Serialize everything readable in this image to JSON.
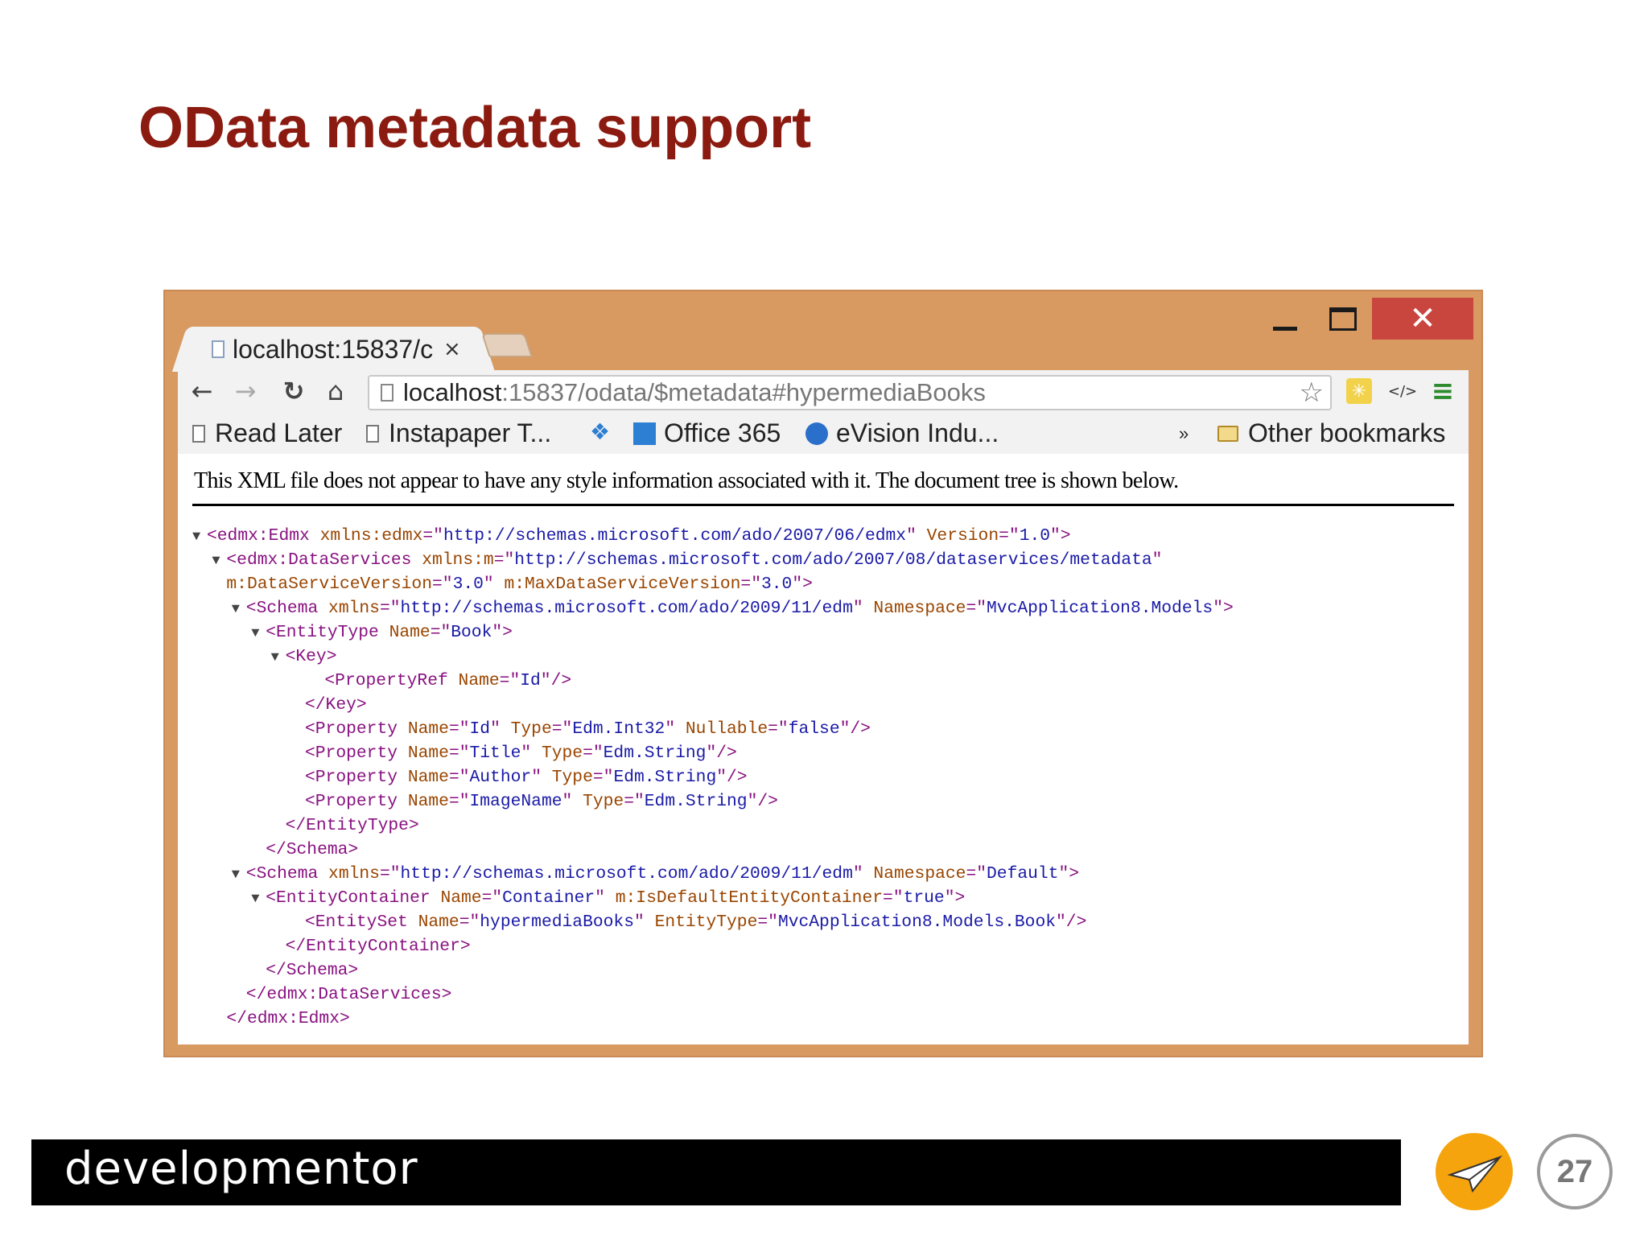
{
  "slide": {
    "title": "OData metadata support",
    "brand": "developmentor",
    "page_number": "27"
  },
  "window": {
    "close_glyph": "✕"
  },
  "tab": {
    "title": "localhost:15837/c",
    "close_glyph": "×"
  },
  "toolbar": {
    "back_icon": "←",
    "forward_icon": "→",
    "reload_icon": "↻",
    "home_icon": "⌂",
    "url_host": "localhost",
    "url_path": ":15837/odata/$metadata#hypermediaBooks",
    "star_icon": "☆",
    "devtools_icon": "</>",
    "menu_icon": "≡"
  },
  "bookmarks": {
    "items": [
      "Read Later",
      "Instapaper T...",
      "Office 365",
      "eVision Indu..."
    ],
    "overflow": "»",
    "other": "Other bookmarks"
  },
  "xml_view": {
    "notice": "This XML file does not appear to have any style information associated with it. The document tree is shown below."
  },
  "xml_lines": [
    {
      "tri": "▼",
      "indent": 0,
      "parts": [
        [
          "t",
          "<edmx:Edmx "
        ],
        [
          "a",
          "xmlns:edmx"
        ],
        [
          "t",
          "=\""
        ],
        [
          "v",
          "http://schemas.microsoft.com/ado/2007/06/edmx"
        ],
        [
          "t",
          "\" "
        ],
        [
          "a",
          "Version"
        ],
        [
          "t",
          "=\""
        ],
        [
          "v",
          "1.0"
        ],
        [
          "t",
          "\">"
        ]
      ]
    },
    {
      "tri": "▼",
      "indent": 1,
      "parts": [
        [
          "t",
          "<edmx:DataServices "
        ],
        [
          "a",
          "xmlns:m"
        ],
        [
          "t",
          "=\""
        ],
        [
          "v",
          "http://schemas.microsoft.com/ado/2007/08/dataservices/metadata"
        ],
        [
          "t",
          "\""
        ]
      ]
    },
    {
      "tri": "",
      "indent": 1,
      "parts": [
        [
          "a",
          "m:DataServiceVersion"
        ],
        [
          "t",
          "=\""
        ],
        [
          "v",
          "3.0"
        ],
        [
          "t",
          "\" "
        ],
        [
          "a",
          "m:MaxDataServiceVersion"
        ],
        [
          "t",
          "=\""
        ],
        [
          "v",
          "3.0"
        ],
        [
          "t",
          "\">"
        ]
      ]
    },
    {
      "tri": "▼",
      "indent": 2,
      "parts": [
        [
          "t",
          "<Schema "
        ],
        [
          "a",
          "xmlns"
        ],
        [
          "t",
          "=\""
        ],
        [
          "v",
          "http://schemas.microsoft.com/ado/2009/11/edm"
        ],
        [
          "t",
          "\" "
        ],
        [
          "a",
          "Namespace"
        ],
        [
          "t",
          "=\""
        ],
        [
          "v",
          "MvcApplication8.Models"
        ],
        [
          "t",
          "\">"
        ]
      ]
    },
    {
      "tri": "▼",
      "indent": 3,
      "parts": [
        [
          "t",
          "<EntityType "
        ],
        [
          "a",
          "Name"
        ],
        [
          "t",
          "=\""
        ],
        [
          "v",
          "Book"
        ],
        [
          "t",
          "\">"
        ]
      ]
    },
    {
      "tri": "▼",
      "indent": 4,
      "parts": [
        [
          "t",
          "<Key>"
        ]
      ]
    },
    {
      "tri": "",
      "indent": 6,
      "parts": [
        [
          "t",
          "<PropertyRef "
        ],
        [
          "a",
          "Name"
        ],
        [
          "t",
          "=\""
        ],
        [
          "v",
          "Id"
        ],
        [
          "t",
          "\"/>"
        ]
      ]
    },
    {
      "tri": "",
      "indent": 5,
      "parts": [
        [
          "t",
          "</Key>"
        ]
      ]
    },
    {
      "tri": "",
      "indent": 5,
      "parts": [
        [
          "t",
          "<Property "
        ],
        [
          "a",
          "Name"
        ],
        [
          "t",
          "=\""
        ],
        [
          "v",
          "Id"
        ],
        [
          "t",
          "\" "
        ],
        [
          "a",
          "Type"
        ],
        [
          "t",
          "=\""
        ],
        [
          "v",
          "Edm.Int32"
        ],
        [
          "t",
          "\" "
        ],
        [
          "a",
          "Nullable"
        ],
        [
          "t",
          "=\""
        ],
        [
          "v",
          "false"
        ],
        [
          "t",
          "\"/>"
        ]
      ]
    },
    {
      "tri": "",
      "indent": 5,
      "parts": [
        [
          "t",
          "<Property "
        ],
        [
          "a",
          "Name"
        ],
        [
          "t",
          "=\""
        ],
        [
          "v",
          "Title"
        ],
        [
          "t",
          "\" "
        ],
        [
          "a",
          "Type"
        ],
        [
          "t",
          "=\""
        ],
        [
          "v",
          "Edm.String"
        ],
        [
          "t",
          "\"/>"
        ]
      ]
    },
    {
      "tri": "",
      "indent": 5,
      "parts": [
        [
          "t",
          "<Property "
        ],
        [
          "a",
          "Name"
        ],
        [
          "t",
          "=\""
        ],
        [
          "v",
          "Author"
        ],
        [
          "t",
          "\" "
        ],
        [
          "a",
          "Type"
        ],
        [
          "t",
          "=\""
        ],
        [
          "v",
          "Edm.String"
        ],
        [
          "t",
          "\"/>"
        ]
      ]
    },
    {
      "tri": "",
      "indent": 5,
      "parts": [
        [
          "t",
          "<Property "
        ],
        [
          "a",
          "Name"
        ],
        [
          "t",
          "=\""
        ],
        [
          "v",
          "ImageName"
        ],
        [
          "t",
          "\" "
        ],
        [
          "a",
          "Type"
        ],
        [
          "t",
          "=\""
        ],
        [
          "v",
          "Edm.String"
        ],
        [
          "t",
          "\"/>"
        ]
      ]
    },
    {
      "tri": "",
      "indent": 4,
      "parts": [
        [
          "t",
          "</EntityType>"
        ]
      ]
    },
    {
      "tri": "",
      "indent": 3,
      "parts": [
        [
          "t",
          "</Schema>"
        ]
      ]
    },
    {
      "tri": "▼",
      "indent": 2,
      "parts": [
        [
          "t",
          "<Schema "
        ],
        [
          "a",
          "xmlns"
        ],
        [
          "t",
          "=\""
        ],
        [
          "v",
          "http://schemas.microsoft.com/ado/2009/11/edm"
        ],
        [
          "t",
          "\" "
        ],
        [
          "a",
          "Namespace"
        ],
        [
          "t",
          "=\""
        ],
        [
          "v",
          "Default"
        ],
        [
          "t",
          "\">"
        ]
      ]
    },
    {
      "tri": "▼",
      "indent": 3,
      "parts": [
        [
          "t",
          "<EntityContainer "
        ],
        [
          "a",
          "Name"
        ],
        [
          "t",
          "=\""
        ],
        [
          "v",
          "Container"
        ],
        [
          "t",
          "\" "
        ],
        [
          "a",
          "m:IsDefaultEntityContainer"
        ],
        [
          "t",
          "=\""
        ],
        [
          "v",
          "true"
        ],
        [
          "t",
          "\">"
        ]
      ]
    },
    {
      "tri": "",
      "indent": 5,
      "parts": [
        [
          "t",
          "<EntitySet "
        ],
        [
          "a",
          "Name"
        ],
        [
          "t",
          "=\""
        ],
        [
          "v",
          "hypermediaBooks"
        ],
        [
          "t",
          "\" "
        ],
        [
          "a",
          "EntityType"
        ],
        [
          "t",
          "=\""
        ],
        [
          "v",
          "MvcApplication8.Models.Book"
        ],
        [
          "t",
          "\"/>"
        ]
      ]
    },
    {
      "tri": "",
      "indent": 4,
      "parts": [
        [
          "t",
          "</EntityContainer>"
        ]
      ]
    },
    {
      "tri": "",
      "indent": 3,
      "parts": [
        [
          "t",
          "</Schema>"
        ]
      ]
    },
    {
      "tri": "",
      "indent": 2,
      "parts": [
        [
          "t",
          "</edmx:DataServices>"
        ]
      ]
    },
    {
      "tri": "",
      "indent": 1,
      "parts": [
        [
          "t",
          "</edmx:Edmx>"
        ]
      ]
    }
  ],
  "colors": {
    "title": "#8b1a10",
    "window_frame": "#d99a62",
    "close_button": "#c9463f",
    "xml_tag": "#881280",
    "xml_attr": "#994500",
    "xml_value": "#1a1aa6",
    "logo": "#f5a40d"
  },
  "icons": {
    "paper_plane": "paper-plane-icon",
    "evernote": "evision-icon",
    "dropbox": "dropbox-icon",
    "office": "office-icon",
    "folder": "folder-icon"
  }
}
